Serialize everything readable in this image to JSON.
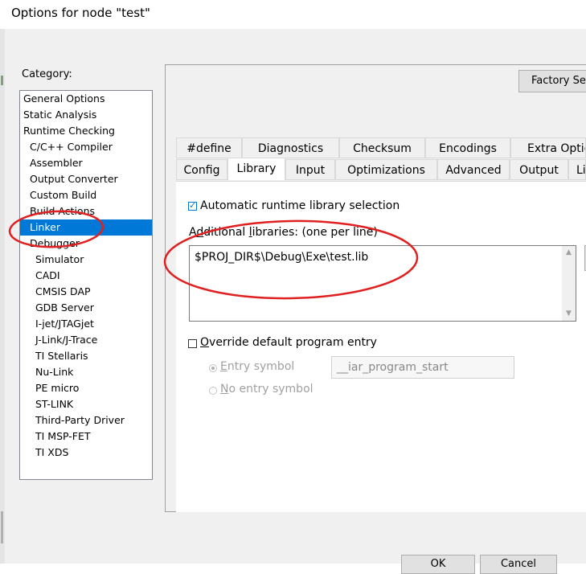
{
  "window": {
    "title": "Options for node \"test\""
  },
  "category": {
    "label": "Category:",
    "items": [
      {
        "label": "General Options"
      },
      {
        "label": "Static Analysis"
      },
      {
        "label": "Runtime Checking"
      },
      {
        "label": "C/C++ Compiler"
      },
      {
        "label": "Assembler"
      },
      {
        "label": "Output Converter"
      },
      {
        "label": "Custom Build"
      },
      {
        "label": "Build Actions"
      },
      {
        "label": "Linker"
      },
      {
        "label": "Debugger"
      },
      {
        "label": "Simulator"
      },
      {
        "label": "CADI"
      },
      {
        "label": "CMSIS DAP"
      },
      {
        "label": "GDB Server"
      },
      {
        "label": "I-jet/JTAGjet"
      },
      {
        "label": "J-Link/J-Trace"
      },
      {
        "label": "TI Stellaris"
      },
      {
        "label": "Nu-Link"
      },
      {
        "label": "PE micro"
      },
      {
        "label": "ST-LINK"
      },
      {
        "label": "Third-Party Driver"
      },
      {
        "label": "TI MSP-FET"
      },
      {
        "label": "TI XDS"
      }
    ],
    "selected": "Linker"
  },
  "factory_button": "Factory Set",
  "tabs_top": [
    "#define",
    "Diagnostics",
    "Checksum",
    "Encodings",
    "Extra Optio"
  ],
  "tabs_bottom": [
    "Config",
    "Library",
    "Input",
    "Optimizations",
    "Advanced",
    "Output",
    "Li"
  ],
  "active_tab": "Library",
  "library": {
    "auto_runtime_label": "Automatic runtime library selection",
    "auto_runtime_checked": true,
    "additional_label_pre": "A",
    "additional_label_u": "d",
    "additional_label_mid": "ditional ",
    "additional_label_u2": "l",
    "additional_label_post": "ibraries: (one per line)",
    "additional_value": "$PROJ_DIR$\\Debug\\Exe\\test.lib",
    "override_u": "O",
    "override_label": "verride default program entry",
    "override_checked": false,
    "entry_symbol_u": "E",
    "entry_symbol_label": "ntry symbol",
    "entry_symbol_value": "__iar_program_start",
    "no_entry_u": "N",
    "no_entry_label": "o entry symbol"
  },
  "buttons": {
    "ok": "OK",
    "cancel": "Cancel"
  },
  "colors": {
    "selection": "#0078d7",
    "annotation": "#e02020"
  }
}
